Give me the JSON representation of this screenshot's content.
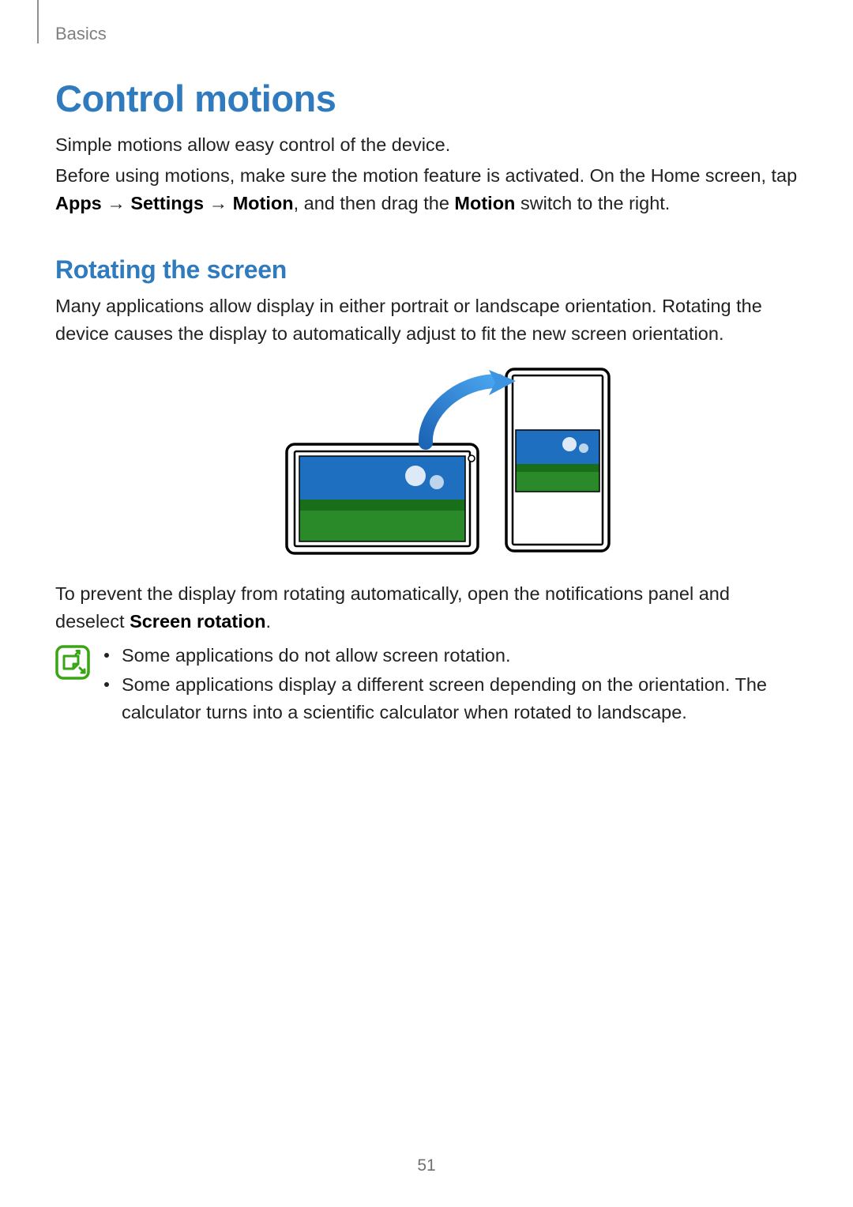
{
  "section_label": "Basics",
  "h1": "Control motions",
  "intro1": "Simple motions allow easy control of the device.",
  "intro2_a": "Before using motions, make sure the motion feature is activated. On the Home screen, tap ",
  "intro2_b": "Apps",
  "intro2_c": " → ",
  "intro2_d": "Settings",
  "intro2_e": " → ",
  "intro2_f": "Motion",
  "intro2_g": ", and then drag the ",
  "intro2_h": "Motion",
  "intro2_i": " switch to the right.",
  "h2": "Rotating the screen",
  "rot_p": "Many applications allow display in either portrait or landscape orientation. Rotating the device causes the display to automatically adjust to fit the new screen orientation.",
  "prevent_a": "To prevent the display from rotating automatically, open the notifications panel and deselect ",
  "prevent_b": "Screen rotation",
  "prevent_c": ".",
  "note1": "Some applications do not allow screen rotation.",
  "note2": "Some applications display a different screen depending on the orientation. The calculator turns into a scientific calculator when rotated to landscape.",
  "page_number": "51"
}
